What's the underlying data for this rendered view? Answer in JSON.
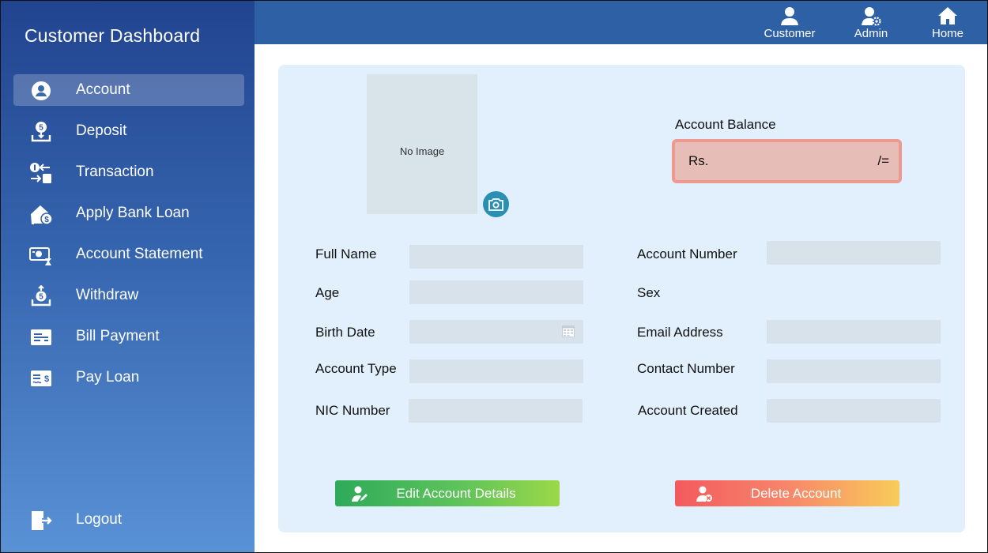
{
  "sidebar": {
    "title": "Customer Dashboard",
    "items": [
      {
        "label": "Account",
        "icon": "account-icon",
        "active": true
      },
      {
        "label": "Deposit",
        "icon": "deposit-icon"
      },
      {
        "label": "Transaction",
        "icon": "transaction-icon"
      },
      {
        "label": "Apply Bank Loan",
        "icon": "house-dollar-icon"
      },
      {
        "label": "Account Statement",
        "icon": "statement-icon"
      },
      {
        "label": "Withdraw",
        "icon": "withdraw-icon"
      },
      {
        "label": "Bill Payment",
        "icon": "bill-icon"
      },
      {
        "label": "Pay Loan",
        "icon": "pay-loan-icon"
      }
    ],
    "logout": {
      "label": "Logout",
      "icon": "logout-icon"
    }
  },
  "topbar": {
    "customer": "Customer",
    "admin": "Admin",
    "home": "Home"
  },
  "profile": {
    "photo_placeholder": "No Image"
  },
  "balance": {
    "label": "Account Balance",
    "prefix": "Rs.",
    "suffix": "/="
  },
  "fields": {
    "full_name": {
      "label": "Full Name",
      "value": ""
    },
    "age": {
      "label": "Age",
      "value": ""
    },
    "birth_date": {
      "label": "Birth Date",
      "value": ""
    },
    "account_type": {
      "label": "Account Type",
      "value": ""
    },
    "nic_number": {
      "label": "NIC Number",
      "value": ""
    },
    "account_number": {
      "label": "Account Number",
      "value": ""
    },
    "sex": {
      "label": "Sex"
    },
    "email": {
      "label": "Email Address",
      "value": ""
    },
    "contact": {
      "label": "Contact Number",
      "value": ""
    },
    "created": {
      "label": "Account Created",
      "value": ""
    }
  },
  "buttons": {
    "edit": "Edit Account Details",
    "delete": "Delete Account"
  },
  "colors": {
    "sidebar_top": "#22448f",
    "sidebar_bottom": "#5a92d6",
    "topbar": "#2e60a5",
    "card": "#e2effc",
    "balance_fill": "#e7bdb8",
    "balance_border": "#ee9990",
    "camera": "#2a8fb2"
  }
}
